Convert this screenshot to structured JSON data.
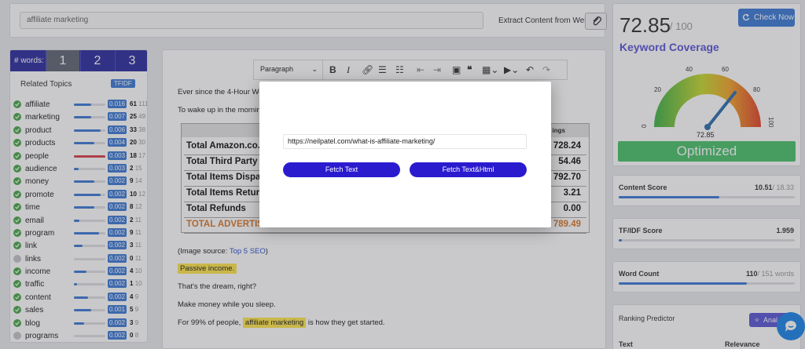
{
  "topbar": {
    "keyword": "affiliate marketing",
    "extract_label": "Extract Content from Web"
  },
  "words": {
    "label": "# words:",
    "tabs": [
      "1",
      "2",
      "3"
    ]
  },
  "related": {
    "title": "Related Topics",
    "tfidf": "TFIDF"
  },
  "topics": [
    {
      "name": "affiliate",
      "score": "0.016",
      "count": "61",
      "total": "111",
      "fill": 0.55,
      "checked": true,
      "red": false
    },
    {
      "name": "marketing",
      "score": "0.007",
      "count": "25",
      "total": "49",
      "fill": 0.55,
      "checked": true,
      "red": false
    },
    {
      "name": "product",
      "score": "0.006",
      "count": "33",
      "total": "38",
      "fill": 0.85,
      "checked": true,
      "red": false
    },
    {
      "name": "products",
      "score": "0.004",
      "count": "20",
      "total": "30",
      "fill": 0.65,
      "checked": true,
      "red": false
    },
    {
      "name": "people",
      "score": "0.003",
      "count": "18",
      "total": "17",
      "fill": 1.0,
      "checked": true,
      "red": true
    },
    {
      "name": "audience",
      "score": "0.003",
      "count": "2",
      "total": "15",
      "fill": 0.15,
      "checked": true,
      "red": false
    },
    {
      "name": "money",
      "score": "0.002",
      "count": "9",
      "total": "14",
      "fill": 0.65,
      "checked": true,
      "red": false
    },
    {
      "name": "promote",
      "score": "0.002",
      "count": "10",
      "total": "12",
      "fill": 0.85,
      "checked": true,
      "red": false
    },
    {
      "name": "time",
      "score": "0.002",
      "count": "8",
      "total": "12",
      "fill": 0.65,
      "checked": true,
      "red": false
    },
    {
      "name": "email",
      "score": "0.002",
      "count": "2",
      "total": "11",
      "fill": 0.18,
      "checked": true,
      "red": false
    },
    {
      "name": "program",
      "score": "0.002",
      "count": "9",
      "total": "11",
      "fill": 0.8,
      "checked": true,
      "red": false
    },
    {
      "name": "link",
      "score": "0.002",
      "count": "3",
      "total": "11",
      "fill": 0.27,
      "checked": true,
      "red": false
    },
    {
      "name": "links",
      "score": "0.002",
      "count": "0",
      "total": "11",
      "fill": 0.0,
      "checked": false,
      "red": false
    },
    {
      "name": "income",
      "score": "0.002",
      "count": "4",
      "total": "10",
      "fill": 0.4,
      "checked": true,
      "red": false
    },
    {
      "name": "traffic",
      "score": "0.002",
      "count": "1",
      "total": "10",
      "fill": 0.1,
      "checked": true,
      "red": false
    },
    {
      "name": "content",
      "score": "0.002",
      "count": "4",
      "total": "9",
      "fill": 0.44,
      "checked": true,
      "red": false
    },
    {
      "name": "sales",
      "score": "0.001",
      "count": "5",
      "total": "9",
      "fill": 0.55,
      "checked": true,
      "red": false
    },
    {
      "name": "blog",
      "score": "0.002",
      "count": "3",
      "total": "9",
      "fill": 0.33,
      "checked": true,
      "red": false
    },
    {
      "name": "programs",
      "score": "0.002",
      "count": "0",
      "total": "8",
      "fill": 0.0,
      "checked": false,
      "red": false
    }
  ],
  "editor": {
    "format": "Paragraph",
    "line1": "Ever since the 4-Hour Wo",
    "line2": "To wake up in the morning",
    "table": {
      "header": "ings",
      "rows": [
        {
          "label": "Total Amazon.co.u",
          "value": "728.24"
        },
        {
          "label": "Total Third Party I",
          "value": "54.46"
        },
        {
          "label": "Total Items Dispa",
          "value": "792.70"
        },
        {
          "label": "Total Items Retur",
          "value": "3.21"
        },
        {
          "label": "Total Refunds",
          "value": "0.00"
        },
        {
          "label": "TOTAL ADVERTIS",
          "value": "789.49"
        }
      ]
    },
    "image_source_prefix": "(Image source: ",
    "image_source_link": "Top 5 SEO",
    "image_source_suffix": ")",
    "passive": "Passive income.",
    "dream": "That's the dream, right?",
    "sleep": "Make money while you sleep.",
    "people_prefix": "For 99% of people,",
    "people_hl": "affiliate marketing",
    "people_suffix": "is how they get started."
  },
  "score": {
    "value": "72.85",
    "outof": "/ 100",
    "check_now": "Check Now",
    "coverage": "Keyword Coverage",
    "gauge_value": "72.85",
    "status": "Optimized"
  },
  "gauge": {
    "ticks": [
      "0",
      "20",
      "40",
      "60",
      "80",
      "100"
    ]
  },
  "content_score": {
    "label": "Content Score",
    "value": "10.51",
    "max": "/ 18.33",
    "fill": 0.573
  },
  "tfidf_score": {
    "label": "TF/IDF Score",
    "value": "1.959",
    "fill": 0.02
  },
  "word_count": {
    "label": "Word Count",
    "value": "110",
    "max": "/ 151 words",
    "fill": 0.728
  },
  "ranking": {
    "title": "Ranking Predictor",
    "button": "Anal",
    "col1": "Text",
    "col2": "Relevance"
  },
  "modal": {
    "url": "https://neilpatel.com/what-is-affiliate-marketing/",
    "fetch_text": "Fetch Text",
    "fetch_html": "Fetch Text&Html"
  },
  "colors": {
    "brand": "#2d2fa0",
    "accent": "#3d7ad6",
    "purple": "#5b57d6",
    "good": "#4cc26b",
    "modal_button": "#2a1bcf"
  }
}
